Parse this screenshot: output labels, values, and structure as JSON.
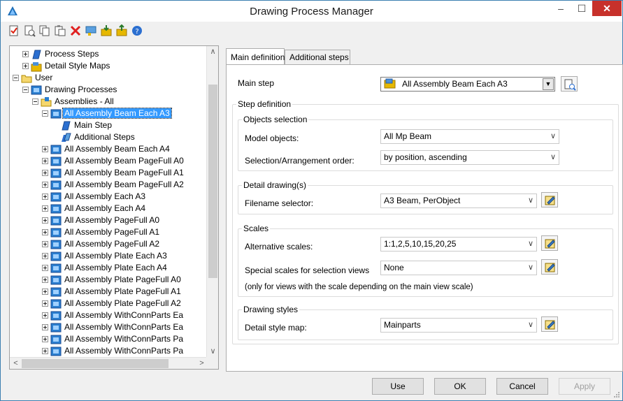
{
  "window": {
    "title": "Drawing Process Manager",
    "minimize": "–",
    "maximize": "☐",
    "close": "✕"
  },
  "toolbar": {
    "icons": [
      "new-icon",
      "open-icon",
      "copy-icon",
      "paste-icon",
      "delete-icon",
      "comment-icon",
      "import-icon",
      "export-icon",
      "help-icon"
    ]
  },
  "tree": {
    "items": [
      {
        "label": "Process Steps",
        "level": 1,
        "icon": "process-steps-icon",
        "expander": "plus"
      },
      {
        "label": "Detail Style Maps",
        "level": 1,
        "icon": "style-maps-icon",
        "expander": "plus"
      },
      {
        "label": "User",
        "level": 0,
        "icon": "folder-icon",
        "expander": "minus"
      },
      {
        "label": "Drawing Processes",
        "level": 1,
        "icon": "process-icon",
        "expander": "minus"
      },
      {
        "label": "Assemblies - All",
        "level": 2,
        "icon": "assembly-folder-icon",
        "expander": "minus"
      },
      {
        "label": "All Assembly Beam Each A3",
        "level": 3,
        "icon": "process-icon",
        "expander": "minus",
        "selected": true
      },
      {
        "label": "Main Step",
        "level": 4,
        "icon": "main-step-icon",
        "expander": "none"
      },
      {
        "label": "Additional Steps",
        "level": 4,
        "icon": "additional-steps-icon",
        "expander": "none"
      },
      {
        "label": "All Assembly Beam Each A4",
        "level": 3,
        "icon": "process-icon",
        "expander": "plus"
      },
      {
        "label": "All Assembly Beam PageFull A0",
        "level": 3,
        "icon": "process-icon",
        "expander": "plus"
      },
      {
        "label": "All Assembly Beam PageFull A1",
        "level": 3,
        "icon": "process-icon",
        "expander": "plus"
      },
      {
        "label": "All Assembly Beam PageFull A2",
        "level": 3,
        "icon": "process-icon",
        "expander": "plus"
      },
      {
        "label": "All Assembly Each A3",
        "level": 3,
        "icon": "process-icon",
        "expander": "plus"
      },
      {
        "label": "All Assembly Each A4",
        "level": 3,
        "icon": "process-icon",
        "expander": "plus"
      },
      {
        "label": "All Assembly PageFull A0",
        "level": 3,
        "icon": "process-icon",
        "expander": "plus"
      },
      {
        "label": "All Assembly PageFull A1",
        "level": 3,
        "icon": "process-icon",
        "expander": "plus"
      },
      {
        "label": "All Assembly PageFull A2",
        "level": 3,
        "icon": "process-icon",
        "expander": "plus"
      },
      {
        "label": "All Assembly Plate Each A3",
        "level": 3,
        "icon": "process-icon",
        "expander": "plus"
      },
      {
        "label": "All Assembly Plate Each A4",
        "level": 3,
        "icon": "process-icon",
        "expander": "plus"
      },
      {
        "label": "All Assembly Plate PageFull A0",
        "level": 3,
        "icon": "process-icon",
        "expander": "plus"
      },
      {
        "label": "All Assembly Plate PageFull A1",
        "level": 3,
        "icon": "process-icon",
        "expander": "plus"
      },
      {
        "label": "All Assembly Plate PageFull A2",
        "level": 3,
        "icon": "process-icon",
        "expander": "plus"
      },
      {
        "label": "All Assembly WithConnParts Ea",
        "level": 3,
        "icon": "process-icon",
        "expander": "plus"
      },
      {
        "label": "All Assembly WithConnParts Ea",
        "level": 3,
        "icon": "process-icon",
        "expander": "plus"
      },
      {
        "label": "All Assembly WithConnParts Pa",
        "level": 3,
        "icon": "process-icon",
        "expander": "plus"
      },
      {
        "label": "All Assembly WithConnParts Pa",
        "level": 3,
        "icon": "process-icon",
        "expander": "plus"
      }
    ],
    "scroll_up": "∧",
    "scroll_down": "∨",
    "scroll_left": "<",
    "scroll_right": ">"
  },
  "tabs": [
    {
      "label": "Main definition",
      "active": true
    },
    {
      "label": "Additional steps",
      "active": false
    }
  ],
  "form": {
    "main_step_label": "Main step",
    "main_step_value": "All Assembly Beam Each A3",
    "step_definition_title": "Step definition",
    "objects_selection_title": "Objects selection",
    "model_objects_label": "Model objects:",
    "model_objects_value": "All Mp Beam",
    "arrangement_label": "Selection/Arrangement order:",
    "arrangement_value": "by position, ascending",
    "detail_drawings_title": "Detail drawing(s)",
    "filename_selector_label": "Filename selector:",
    "filename_selector_value": "A3 Beam, PerObject",
    "scales_title": "Scales",
    "alt_scales_label": "Alternative scales:",
    "alt_scales_value": "1:1,2,5,10,15,20,25",
    "special_scales_label": "Special scales for selection views",
    "special_scales_value": "None",
    "special_scales_note": "(only for views with the scale depending on the main view scale)",
    "drawing_styles_title": "Drawing styles",
    "detail_style_map_label": "Detail style map:",
    "detail_style_map_value": "Mainparts"
  },
  "buttons": {
    "use": "Use",
    "ok": "OK",
    "cancel": "Cancel",
    "apply": "Apply"
  },
  "colors": {
    "selection": "#3399ff",
    "close_button": "#c7312b"
  }
}
